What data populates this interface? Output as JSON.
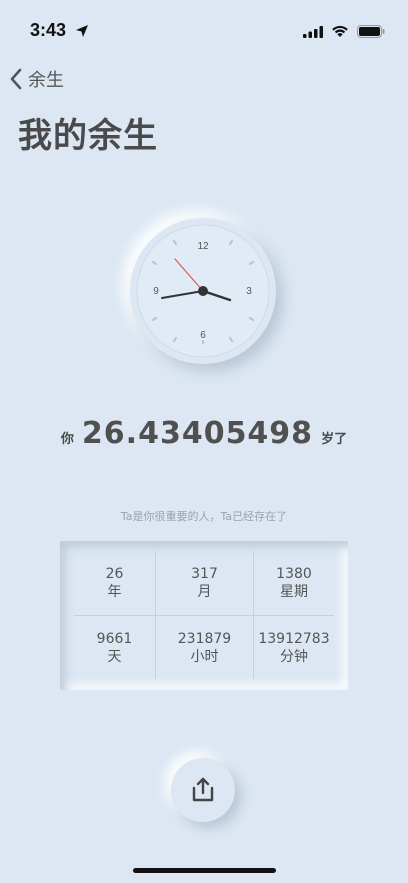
{
  "status_bar": {
    "time": "3:43"
  },
  "nav": {
    "back_label": "余生"
  },
  "page": {
    "title": "我的余生"
  },
  "clock": {
    "numbers": {
      "top": "12",
      "right": "3",
      "bottom": "6",
      "left": "9"
    },
    "second_hand_color": "#e05a5a"
  },
  "age": {
    "prefix": "你",
    "value": "26.43405498",
    "suffix": "岁了"
  },
  "caption": "Ta是你很重要的人，Ta已经存在了",
  "stats": [
    {
      "value": "26",
      "unit": "年"
    },
    {
      "value": "317",
      "unit": "月"
    },
    {
      "value": "1380",
      "unit": "星期"
    },
    {
      "value": "9661",
      "unit": "天"
    },
    {
      "value": "231879",
      "unit": "小时"
    },
    {
      "value": "13912783",
      "unit": "分钟"
    }
  ],
  "colors": {
    "background": "#dce7f3",
    "text": "#4a4a4a"
  }
}
